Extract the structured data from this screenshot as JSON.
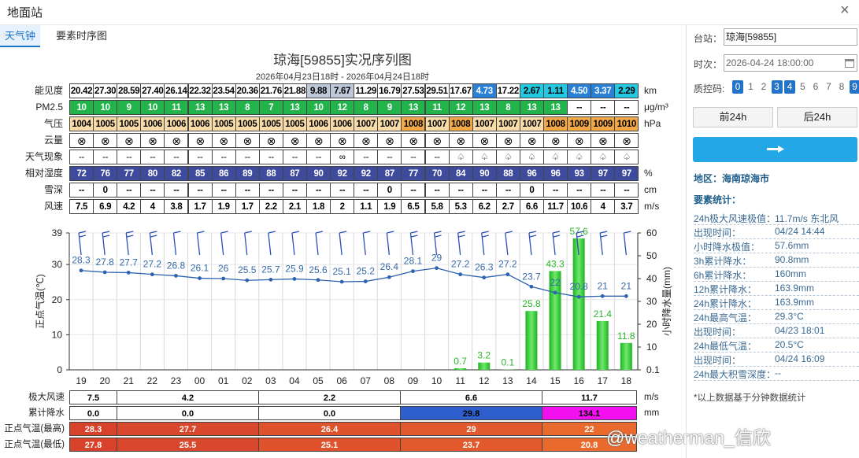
{
  "window": {
    "title": "地面站",
    "close": "×"
  },
  "tabs": [
    "天气钟",
    "要素时序图"
  ],
  "chart_title": "琼海[59855]实况序列图",
  "chart_subtitle": "2026年04月23日18时 - 2026年04月24日18时",
  "colors": {
    "tab_active": "#1a73c9",
    "pm_green": "#22b34a",
    "humidity_blue": "#3e4a9c",
    "tmax_red": "#d9322a",
    "pres_light": "#f7dba8",
    "pres_dark": "#f0a848",
    "bar_green": "#3dcc3d",
    "rain_blue": "#2f5fcc",
    "rain_magenta": "#f20ff0",
    "line_blue": "#2c62b0",
    "button_blue": "#23a7e6",
    "qc_blue": "#2374c9"
  },
  "table_rows": [
    {
      "label": "能见度",
      "unit": "km",
      "values": [
        "20.42",
        "27.30",
        "28.59",
        "27.40",
        "26.14",
        "22.32",
        "23.54",
        "20.36",
        "21.76",
        "21.88",
        "9.88",
        "7.67",
        "11.29",
        "16.79",
        "27.53",
        "29.51",
        "17.67",
        "4.73",
        "17.22",
        "2.67",
        "1.11",
        "4.50",
        "3.37",
        "2.29"
      ]
    },
    {
      "label": "PM2.5",
      "unit": "μg/m³",
      "values": [
        "10",
        "10",
        "9",
        "10",
        "11",
        "13",
        "13",
        "8",
        "7",
        "13",
        "10",
        "12",
        "8",
        "9",
        "13",
        "11",
        "12",
        "13",
        "8",
        "13",
        "13",
        "--",
        "--",
        "--"
      ]
    },
    {
      "label": "气压",
      "unit": "hPa",
      "values": [
        "1004",
        "1005",
        "1005",
        "1006",
        "1006",
        "1006",
        "1005",
        "1005",
        "1005",
        "1005",
        "1006",
        "1006",
        "1007",
        "1007",
        "1008",
        "1007",
        "1008",
        "1007",
        "1007",
        "1007",
        "1008",
        "1009",
        "1009",
        "1010"
      ]
    },
    {
      "label": "云量",
      "unit": "",
      "values": [
        "⊗",
        "⊗",
        "⊗",
        "⊗",
        "⊗",
        "⊗",
        "⊗",
        "⊗",
        "⊗",
        "⊗",
        "⊗",
        "⊗",
        "⊗",
        "⊗",
        "⊗",
        "⊗",
        "⊗",
        "⊗",
        "⊗",
        "⊗",
        "⊗",
        "⊗",
        "⊗",
        "⊗"
      ]
    },
    {
      "label": "天气现象",
      "unit": "",
      "values": [
        "--",
        "--",
        "--",
        "--",
        "--",
        "--",
        "--",
        "--",
        "--",
        "--",
        "--",
        "∞",
        "--",
        "--",
        "--",
        "--",
        "♤",
        "♤",
        "♤",
        "♤",
        "♤",
        "♤",
        "♤",
        "♤"
      ]
    },
    {
      "label": "相对湿度",
      "unit": "%",
      "values": [
        "72",
        "76",
        "77",
        "80",
        "82",
        "85",
        "86",
        "89",
        "88",
        "87",
        "90",
        "92",
        "92",
        "87",
        "77",
        "70",
        "84",
        "90",
        "88",
        "96",
        "96",
        "93",
        "97",
        "97"
      ]
    },
    {
      "label": "雪深",
      "unit": "cm",
      "values": [
        "--",
        "0",
        "--",
        "--",
        "--",
        "--",
        "--",
        "--",
        "--",
        "--",
        "--",
        "--",
        "--",
        "0",
        "--",
        "--",
        "--",
        "--",
        "--",
        "0",
        "--",
        "--",
        "--",
        "--"
      ]
    },
    {
      "label": "风速",
      "unit": "m/s",
      "values": [
        "7.5",
        "6.9",
        "4.2",
        "4",
        "3.8",
        "1.7",
        "1.9",
        "1.7",
        "2.2",
        "2.1",
        "1.8",
        "2",
        "1.1",
        "1.9",
        "6.5",
        "5.8",
        "5.3",
        "6.2",
        "2.7",
        "6.6",
        "11.7",
        "10.6",
        "4",
        "3.7"
      ]
    }
  ],
  "chart_data": {
    "type": "line",
    "categories": [
      "19",
      "20",
      "21",
      "22",
      "23",
      "00",
      "01",
      "02",
      "03",
      "04",
      "05",
      "06",
      "07",
      "08",
      "09",
      "10",
      "11",
      "12",
      "13",
      "14",
      "15",
      "16",
      "17",
      "18"
    ],
    "series": [
      {
        "values": [
          28.3,
          27.8,
          27.7,
          27.2,
          26.8,
          26.1,
          26,
          25.5,
          25.7,
          25.9,
          25.6,
          25.1,
          25.2,
          26.4,
          28.1,
          29,
          27.2,
          26.3,
          27.2,
          23.7,
          22,
          20.8,
          21,
          21
        ]
      },
      {
        "values": [
          null,
          null,
          null,
          null,
          null,
          null,
          null,
          null,
          null,
          null,
          null,
          null,
          null,
          null,
          null,
          null,
          0.7,
          3.2,
          0.1,
          25.8,
          43.3,
          57.6,
          21.4,
          11.8
        ]
      }
    ],
    "ylabel": "正点气温(℃)",
    "ylabel_right": "小时降水量(mm)",
    "ylim": [
      0,
      39
    ],
    "ylim_right": [
      0.1,
      60
    ],
    "yticks": [
      "0",
      "10",
      "20",
      "30",
      "39"
    ],
    "yticks_right": [
      "0.1",
      "10",
      "20",
      "30",
      "40",
      "50",
      "60"
    ],
    "grid": true
  },
  "bottom_rows": [
    {
      "label": "极大风速",
      "unit": "m/s",
      "values": [
        "7.5",
        "4.2",
        "2.2",
        "6.6",
        "11.7"
      ]
    },
    {
      "label": "累计降水",
      "unit": "mm",
      "values": [
        "0.0",
        "0.0",
        "0.0",
        "29.8",
        "134.1"
      ]
    },
    {
      "label": "正点气温(最高)",
      "unit": "",
      "values": [
        "28.3",
        "27.7",
        "26.4",
        "29",
        "22"
      ]
    },
    {
      "label": "正点气温(最低)",
      "unit": "",
      "values": [
        "27.8",
        "25.5",
        "25.1",
        "23.7",
        "20.8"
      ]
    }
  ],
  "sidebar": {
    "station_label": "台站：",
    "station_value": "琼海[59855]",
    "time_label": "时次：",
    "time_value": "2026-04-24 18:00:00",
    "qc_label": "质控码:",
    "qc_codes": [
      "0",
      "1",
      "2",
      "3",
      "4",
      "5",
      "6",
      "7",
      "8",
      "9"
    ],
    "prev_label": "前24h",
    "next_label": "后24h",
    "region": "地区：海南琼海市",
    "stats_title": "要素统计：",
    "stats": [
      {
        "k": "24h极大风速极值：",
        "v": "11.7m/s 东北风"
      },
      {
        "k": "出现时间：",
        "v": "04/24 14:44"
      },
      {
        "k": "小时降水极值：",
        "v": "57.6mm"
      },
      {
        "k": "3h累计降水：",
        "v": "90.8mm"
      },
      {
        "k": "6h累计降水：",
        "v": "160mm"
      },
      {
        "k": "12h累计降水：",
        "v": "163.9mm"
      },
      {
        "k": "24h累计降水：",
        "v": "163.9mm"
      },
      {
        "k": "24h最高气温：",
        "v": "29.3°C"
      },
      {
        "k": "出现时间：",
        "v": "04/23 18:01"
      },
      {
        "k": "24h最低气温：",
        "v": "20.5°C"
      },
      {
        "k": "出现时间：",
        "v": "04/24 16:09"
      },
      {
        "k": "24h最大积雪深度：",
        "v": "--"
      }
    ],
    "note": "*以上数据基于分钟数据统计"
  },
  "watermark": "@weatherman_信欣"
}
